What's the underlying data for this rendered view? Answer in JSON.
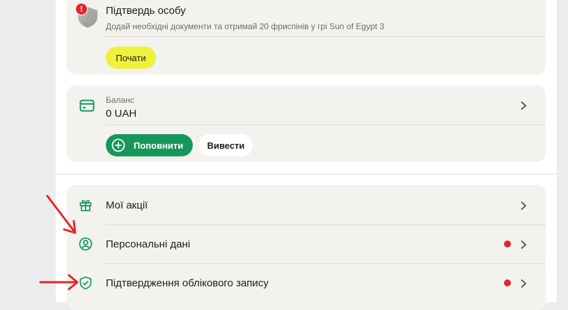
{
  "verify": {
    "title": "Підтвердь особу",
    "subtitle": "Додай необхідні документи та отримай 20 фриспінів у грі Sun of Egypt 3",
    "badge": "!",
    "start_button": "Почати"
  },
  "balance": {
    "label": "Баланс",
    "value": "0 UAH",
    "topup_button": "Поповнити",
    "withdraw_button": "Вивести"
  },
  "menu": {
    "items": [
      {
        "label": "Мої акції",
        "icon": "gift-icon",
        "has_notification": false
      },
      {
        "label": "Персональні дані",
        "icon": "user-circle-icon",
        "has_notification": true
      },
      {
        "label": "Підтвердження облікового запису",
        "icon": "shield-check-icon",
        "has_notification": true
      }
    ]
  },
  "colors": {
    "accent_green": "#16975a",
    "start_yellow": "#eff23a",
    "alert_red": "#e0262d",
    "card_bg": "#f3f2ee",
    "annotation_arrow": "#e0262d"
  }
}
